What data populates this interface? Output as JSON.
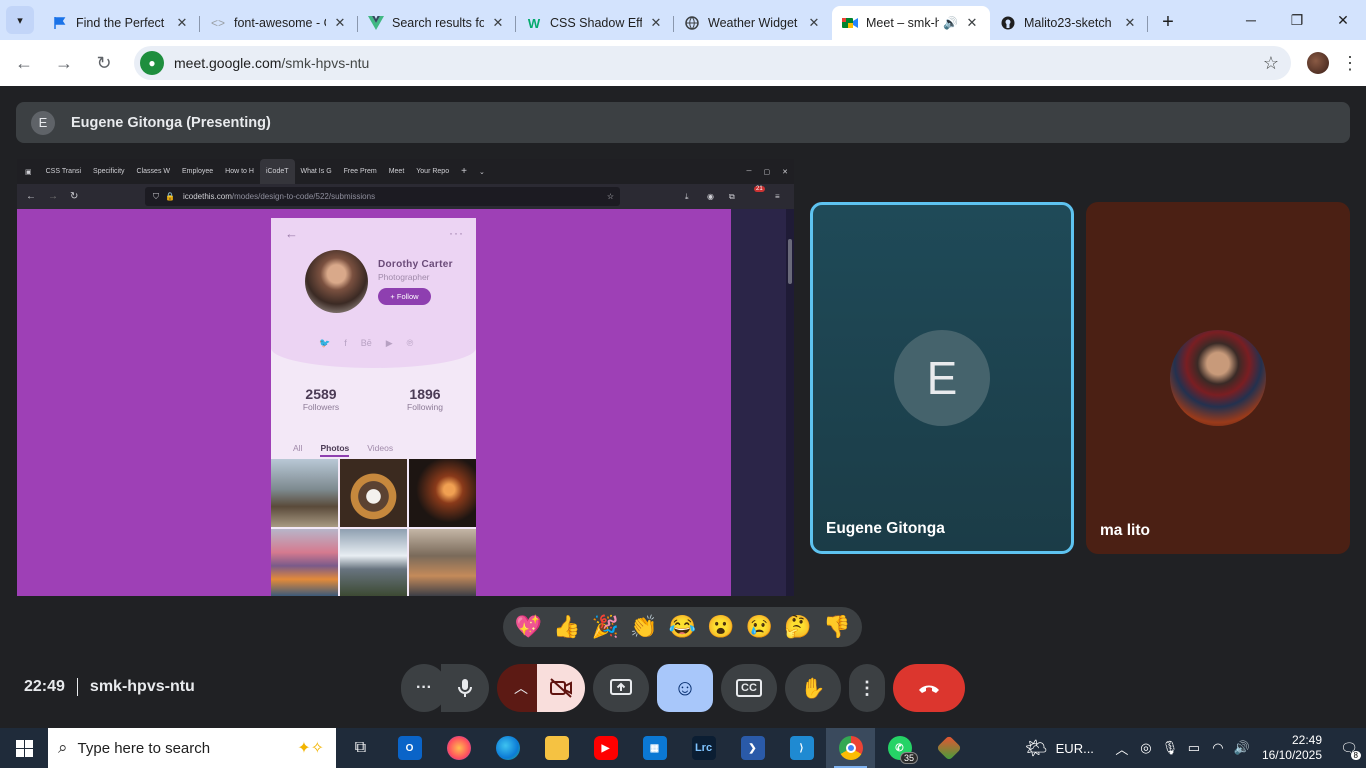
{
  "browser": {
    "tabs": [
      {
        "title": "Find the Perfect Free",
        "favicon": "flag-icon",
        "color": "#1a73e8"
      },
      {
        "title": "font-awesome - Googl",
        "favicon": "code-icon",
        "color": "#9aa0a6"
      },
      {
        "title": "Search results for",
        "favicon": "vue-icon",
        "color": "#41b883"
      },
      {
        "title": "CSS Shadow Effects",
        "favicon": "w3-icon",
        "color": "#04aa6d"
      },
      {
        "title": "Weather Widget",
        "favicon": "globe-icon",
        "color": "#3c4043"
      },
      {
        "title": "Meet – smk-hpvs-ntu",
        "favicon": "meet-icon",
        "color": "#00832d",
        "active": true
      },
      {
        "title": "Malito23-sketch",
        "favicon": "github-icon",
        "color": "#1f1f1f"
      }
    ],
    "address": {
      "host": "meet.google.com",
      "path": "/smk-hpvs-ntu"
    }
  },
  "meet": {
    "presenter": {
      "initial": "E",
      "label": "Eugene Gitonga (Presenting)"
    },
    "shared_screen": {
      "tabs": [
        "CSS Transi",
        "Specificity",
        "Classes W",
        "Employee",
        "How to H",
        "iCodeT",
        "What Is G",
        "Free Prem",
        "Meet",
        "Your Repo"
      ],
      "notification_count": "21",
      "url_host": "icodethis.com",
      "url_path": "/modes/design-to-code/522/submissions",
      "profile_card": {
        "name": "Dorothy  Carter",
        "role": "Photographer",
        "follow_label": "+ Follow",
        "followers_count": "2589",
        "followers_label": "Followers",
        "following_count": "1896",
        "following_label": "Following",
        "tabs": [
          "All",
          "Photos",
          "Videos"
        ]
      }
    },
    "participants": [
      {
        "name": "Eugene Gitonga",
        "initial": "E",
        "speaking": true
      },
      {
        "name": "ma lito"
      }
    ],
    "reactions": [
      "💖",
      "👍",
      "🎉",
      "👏",
      "😂",
      "😮",
      "😢",
      "🤔",
      "👎"
    ],
    "time": "22:49",
    "meeting_code": "smk-hpvs-ntu"
  },
  "taskbar": {
    "search_placeholder": "Type here to search",
    "whatsapp_badge": "35",
    "weather_label": "EUR...",
    "clock_time": "22:49",
    "clock_date": "16/10/2025",
    "notification_count": "8",
    "lightroom_label": "Lrc"
  },
  "colors": {
    "tabstrip": "#d3e3fd",
    "meet_bg": "#202124",
    "speaking_border": "#5ec3f0",
    "hangup": "#dc362e",
    "emoji_active": "#a8c7fa",
    "shared_bg": "#9e40b6"
  }
}
